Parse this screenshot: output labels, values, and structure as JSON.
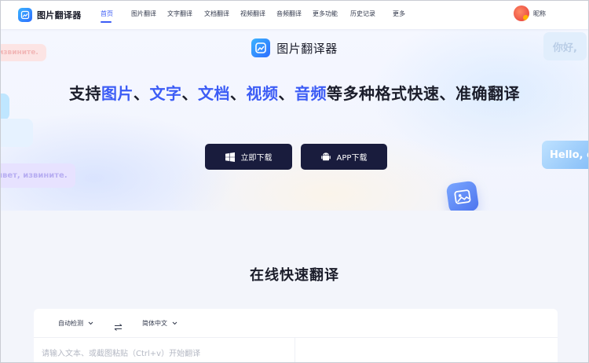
{
  "nav": {
    "brand": "图片翻译器",
    "links": [
      {
        "label": "首页",
        "active": true
      },
      {
        "label": "图片翻译",
        "active": false
      },
      {
        "label": "文字翻译",
        "active": false
      },
      {
        "label": "文档翻译",
        "active": false
      },
      {
        "label": "视频翻译",
        "active": false
      },
      {
        "label": "音频翻译",
        "active": false
      },
      {
        "label": "更多功能",
        "active": false
      },
      {
        "label": "历史记录",
        "active": false
      },
      {
        "label": "更多",
        "active": false
      }
    ],
    "user_name": "昵称"
  },
  "hero": {
    "logo_text": "图片翻译器",
    "headline_prefix": "支持",
    "headline_items": [
      "图片",
      "文字",
      "文档",
      "视频",
      "音频"
    ],
    "headline_separator": "、",
    "headline_suffix": "等多种格式快速、准确翻译",
    "download_label": "立即下载",
    "app_label": "APP下载",
    "bubbles": {
      "top_left": "извините.",
      "bottom_left": "ивет, извините.",
      "top_right": "你好,",
      "right": "Hello, c"
    }
  },
  "online": {
    "title": "在线快速翻译",
    "source_lang": "自动检测",
    "target_lang": "简体中文",
    "placeholder": "请输入文本、或截图粘贴（Ctrl+v）开始翻译"
  },
  "colors": {
    "accent": "#3c5cf5",
    "dark_button": "#191c3d",
    "text": "#1b1d2a"
  }
}
